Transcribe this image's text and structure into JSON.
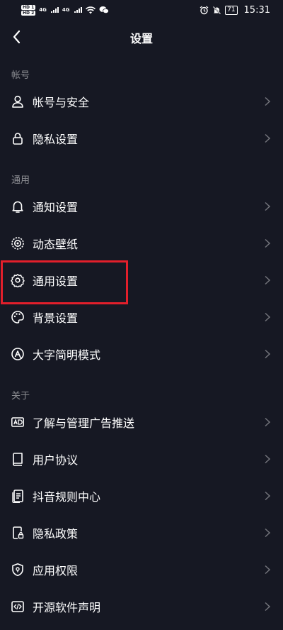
{
  "status_bar": {
    "sim1": "HD 1",
    "sim2": "HD 2",
    "net1": "4G",
    "net2": "4G",
    "battery": "71",
    "time": "15:31"
  },
  "header": {
    "title": "设置"
  },
  "sections": {
    "account": {
      "label": "帐号",
      "items": [
        {
          "label": "帐号与安全",
          "icon": "user-icon"
        },
        {
          "label": "隐私设置",
          "icon": "lock-icon"
        }
      ]
    },
    "general": {
      "label": "通用",
      "items": [
        {
          "label": "通知设置",
          "icon": "bell-icon"
        },
        {
          "label": "动态壁纸",
          "icon": "wallpaper-icon"
        },
        {
          "label": "通用设置",
          "icon": "gear-icon"
        },
        {
          "label": "背景设置",
          "icon": "palette-icon"
        },
        {
          "label": "大字简明模式",
          "icon": "large-text-icon"
        }
      ]
    },
    "about": {
      "label": "关于",
      "items": [
        {
          "label": "了解与管理广告推送",
          "icon": "ad-icon"
        },
        {
          "label": "用户协议",
          "icon": "book-icon"
        },
        {
          "label": "抖音规则中心",
          "icon": "rules-doc-icon"
        },
        {
          "label": "隐私政策",
          "icon": "privacy-doc-icon"
        },
        {
          "label": "应用权限",
          "icon": "shield-icon"
        },
        {
          "label": "开源软件声明",
          "icon": "code-icon"
        }
      ]
    }
  },
  "highlight_color": "#e21f2b",
  "background_color": "#161823"
}
